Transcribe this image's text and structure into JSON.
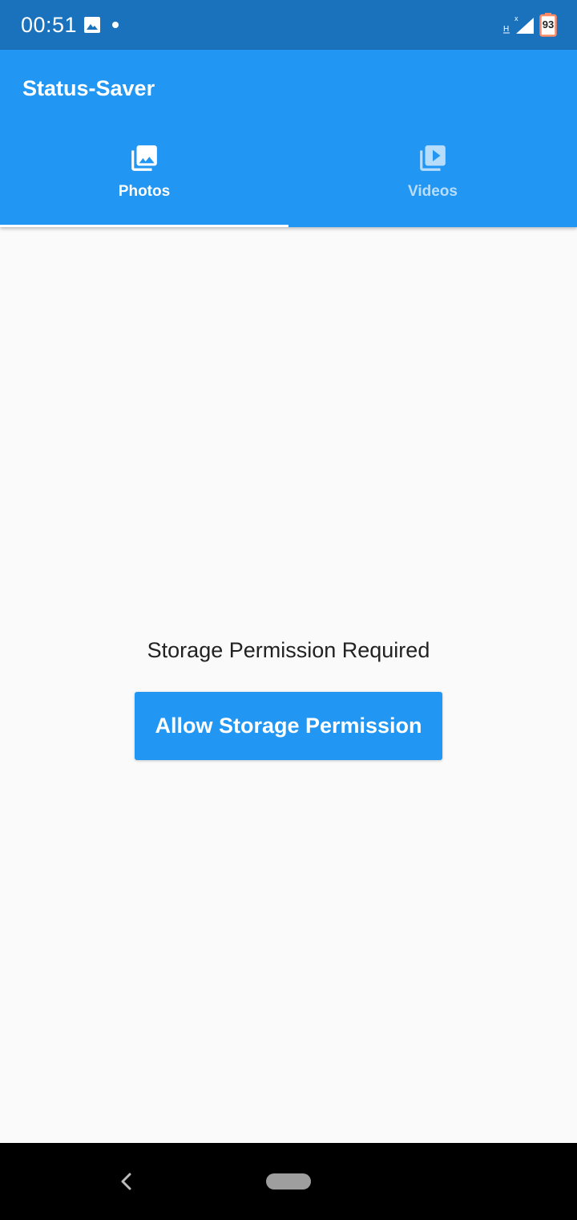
{
  "status_bar": {
    "time": "00:51",
    "battery_level": "93",
    "network_label": "H",
    "icons": [
      "gallery-icon",
      "notification-dot",
      "signal-icon",
      "battery-icon"
    ]
  },
  "app_bar": {
    "title": "Status-Saver"
  },
  "tabs": [
    {
      "label": "Photos",
      "icon": "photo-library-icon",
      "selected": true
    },
    {
      "label": "Videos",
      "icon": "video-library-icon",
      "selected": false
    }
  ],
  "main": {
    "message": "Storage Permission Required",
    "button_label": "Allow Storage Permission"
  },
  "nav_bar": {
    "icons": [
      "back-icon",
      "home-pill"
    ]
  },
  "colors": {
    "status_bar": "#1b72bc",
    "primary": "#2196f3",
    "background": "#fafafa",
    "text": "#222222",
    "nav_bar": "#000000"
  }
}
